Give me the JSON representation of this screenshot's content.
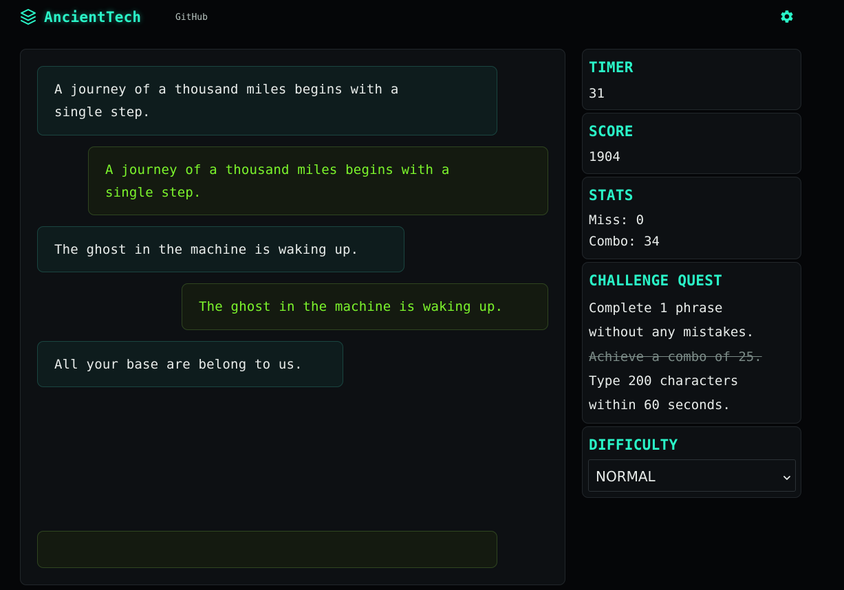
{
  "header": {
    "brand_icon": "stacked-layers-icon",
    "brand_name": "AncientTech",
    "github_label": "GitHub",
    "settings_icon": "gear-icon"
  },
  "chat": {
    "messages": [
      {
        "role": "prompt",
        "lines": [
          "A journey of a thousand miles begins with a",
          "single step."
        ]
      },
      {
        "role": "typed",
        "lines": [
          "A journey of a thousand miles begins with a",
          "single step."
        ]
      },
      {
        "role": "prompt",
        "lines": [
          "The ghost in the machine is waking up."
        ]
      },
      {
        "role": "typed",
        "lines": [
          "The ghost in the machine is waking up."
        ]
      },
      {
        "role": "prompt",
        "lines": [
          "All your base are belong to us."
        ]
      }
    ],
    "input_value": ""
  },
  "sidebar": {
    "timer": {
      "title": "TIMER",
      "value": "31"
    },
    "score": {
      "title": "SCORE",
      "value": "1904"
    },
    "stats": {
      "title": "STATS",
      "miss": "Miss: 0",
      "combo": "Combo: 34"
    },
    "quest": {
      "title": "CHALLENGE QUEST",
      "lines": [
        {
          "text": "Complete 1 phrase",
          "done": false
        },
        {
          "text": "without any mistakes.",
          "done": false
        },
        {
          "text": "Achieve a combo of 25.",
          "done": true
        },
        {
          "text": "Type 200 characters",
          "done": false
        },
        {
          "text": "within 60 seconds.",
          "done": false
        }
      ]
    },
    "difficulty": {
      "title": "DIFFICULTY",
      "selected": "NORMAL"
    }
  },
  "colors": {
    "accent": "#2af5c8",
    "typed_text": "#7cf52c",
    "background": "#050608",
    "panel": "#0d1013"
  }
}
